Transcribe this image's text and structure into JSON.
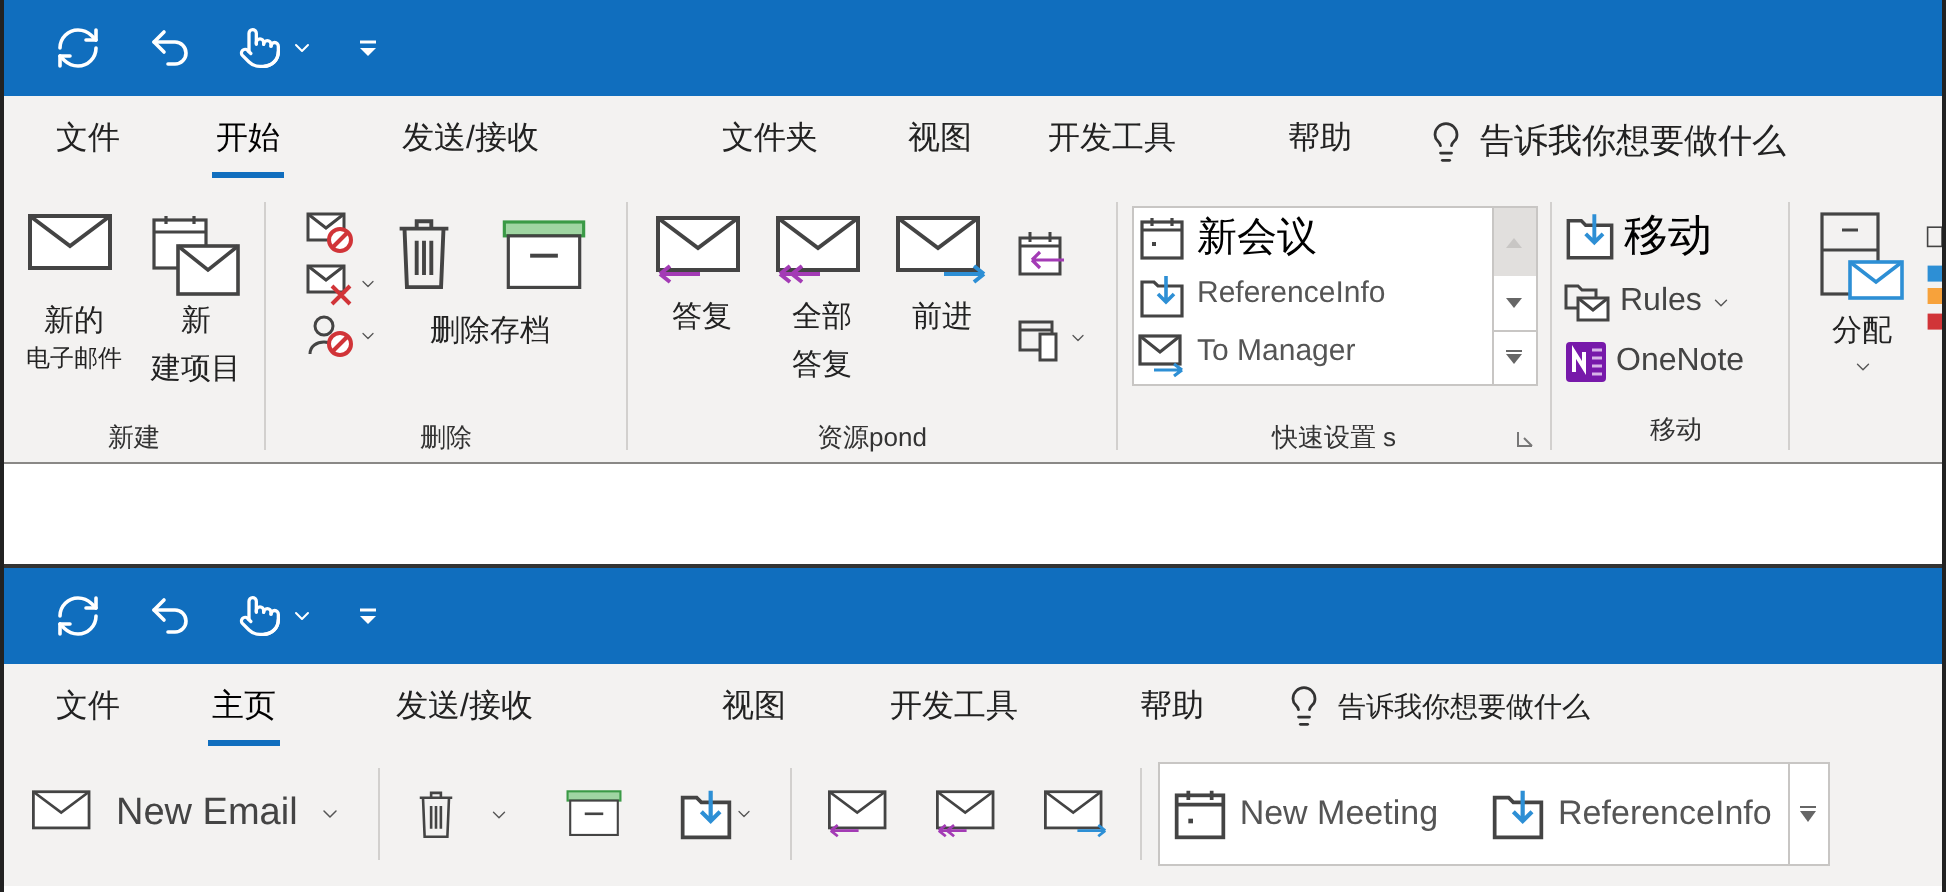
{
  "top": {
    "tabs": [
      {
        "label": "文件",
        "selected": false
      },
      {
        "label": "开始",
        "selected": true
      },
      {
        "label": "发送/接收",
        "selected": false
      },
      {
        "label": "文件夹",
        "selected": false
      },
      {
        "label": "视图",
        "selected": false
      },
      {
        "label": "开发工具",
        "selected": false
      },
      {
        "label": "帮助",
        "selected": false
      }
    ],
    "tell_me": "告诉我你想要做什么",
    "new_group": {
      "label": "新建",
      "new_email": [
        "新的",
        "电子邮件"
      ],
      "new_items": [
        "新",
        "建项目"
      ]
    },
    "delete_group": {
      "label": "删除",
      "buttons_label": "删除存档"
    },
    "respond_group": {
      "label": "资源pond",
      "reply": "答复",
      "reply_all": [
        "全部",
        "答复"
      ],
      "forward": "前进"
    },
    "quick_steps": {
      "label": "快速设置 s",
      "items": [
        {
          "label": "新会议",
          "kind": "calendar"
        },
        {
          "label": "ReferenceInfo",
          "kind": "folder"
        },
        {
          "label": "To Manager",
          "kind": "mail"
        }
      ]
    },
    "move_group": {
      "label": "移动",
      "move": "移动",
      "rules": "Rules",
      "onenote": "OneNote"
    },
    "assign": {
      "label": "分配"
    }
  },
  "bottom": {
    "tabs": [
      {
        "label": "文件",
        "selected": false
      },
      {
        "label": "主页",
        "selected": true
      },
      {
        "label": "发送/接收",
        "selected": false
      },
      {
        "label": "视图",
        "selected": false
      },
      {
        "label": "开发工具",
        "selected": false
      },
      {
        "label": "帮助",
        "selected": false
      }
    ],
    "tell_me": "告诉我你想要做什么",
    "new_email": "New Email",
    "quick_steps": [
      {
        "label": "New Meeting",
        "kind": "calendar"
      },
      {
        "label": "ReferenceInfo",
        "kind": "folder"
      }
    ]
  }
}
